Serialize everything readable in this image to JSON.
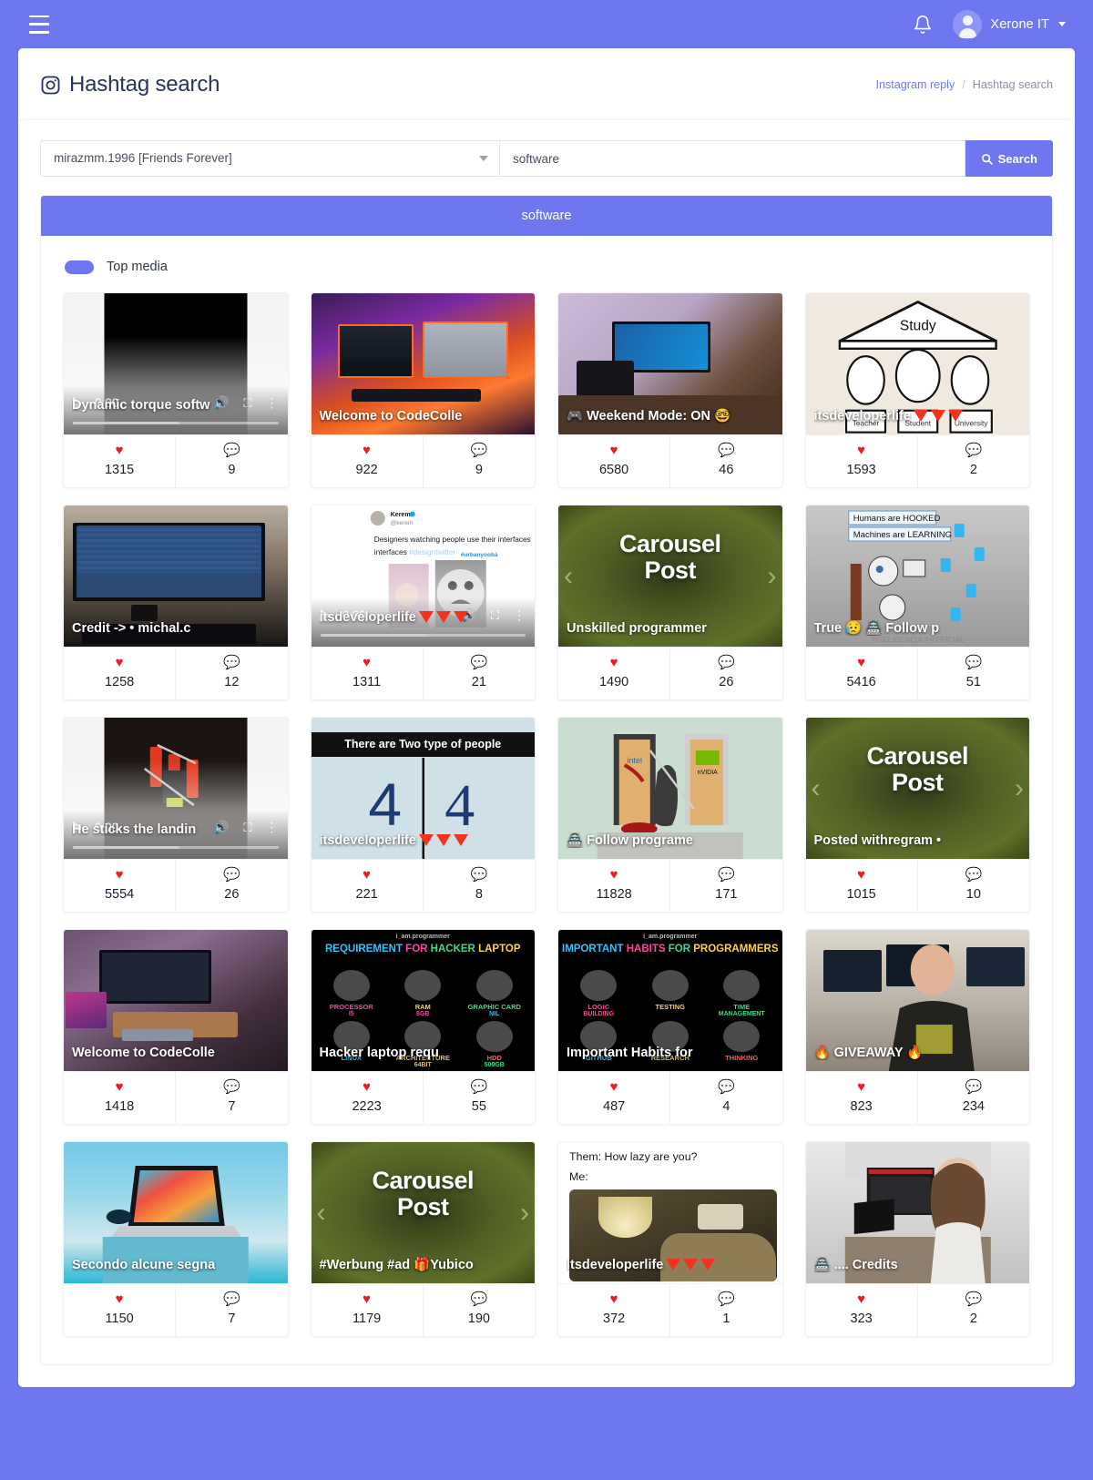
{
  "topnav": {
    "menu_icon": "hamburger-icon",
    "notification_icon": "bell-icon",
    "user_name": "Xerone IT",
    "avatar_icon": "user-avatar-icon",
    "caret_icon": "chevron-down-icon"
  },
  "page": {
    "title": "Hashtag search",
    "title_icon": "instagram-icon",
    "breadcrumb": {
      "parent": "Instagram reply",
      "separator": "/",
      "current": "Hashtag search"
    }
  },
  "search": {
    "account_selected": "mirazmm.1996 [Friends Forever]",
    "keyword_value": "software",
    "keyword_placeholder": "software",
    "button_label": "Search",
    "button_icon": "search-icon"
  },
  "results": {
    "header": "software",
    "toggle_label": "Top media",
    "toggle_on": true
  },
  "colors": {
    "brand": "#6e77f0",
    "heart": "#ec1c24",
    "comment": "#6271e8",
    "title_text": "#29335c"
  },
  "icons": {
    "like": "heart-icon",
    "comment": "comment-bubble-icon",
    "play": "play-icon",
    "volume": "volume-icon",
    "fullscreen": "fullscreen-icon",
    "more": "more-vertical-icon",
    "prev": "chevron-left-icon",
    "next": "chevron-right-icon"
  },
  "media": [
    {
      "caption": "Dynamic torque softw",
      "likes": "1315",
      "comments": "9",
      "kind": "video",
      "time": "0:00",
      "style": "black-video"
    },
    {
      "caption": "Welcome to CodeColle",
      "likes": "922",
      "comments": "9",
      "kind": "image",
      "style": "rgb-desk"
    },
    {
      "caption": "🎮 Weekend Mode: ON 🤓",
      "likes": "6580",
      "comments": "46",
      "kind": "image",
      "style": "gamer"
    },
    {
      "caption": "itsdeveloperlife",
      "likes": "1593",
      "comments": "2",
      "kind": "image",
      "style": "study-cartoon",
      "triangles": 3
    },
    {
      "caption": "Credit -> • michal.c",
      "likes": "1258",
      "comments": "12",
      "kind": "image",
      "style": "ultrawide-code"
    },
    {
      "caption": "itsdeveloperlife",
      "likes": "1311",
      "comments": "21",
      "kind": "video",
      "time": "0:00",
      "style": "tweet-video",
      "triangles": 3
    },
    {
      "caption": "Unskilled programmer",
      "likes": "1490",
      "comments": "26",
      "kind": "carousel",
      "style": "carousel",
      "carousel_title": "Carousel Post"
    },
    {
      "caption": "True 😥 🏯 Follow p",
      "likes": "5416",
      "comments": "51",
      "kind": "image",
      "style": "robots"
    },
    {
      "caption": "He sticks the landin",
      "likes": "5554",
      "comments": "26",
      "kind": "video",
      "time": "0:00",
      "style": "robot-arm"
    },
    {
      "caption": "itsdeveloperlife",
      "likes": "221",
      "comments": "8",
      "kind": "image",
      "style": "two-types",
      "triangles": 3
    },
    {
      "caption": "🏯 Follow programe",
      "likes": "11828",
      "comments": "171",
      "kind": "image",
      "style": "doors"
    },
    {
      "caption": "Posted withregram •",
      "likes": "1015",
      "comments": "10",
      "kind": "carousel",
      "style": "carousel",
      "carousel_title": "Carousel Post"
    },
    {
      "caption": "Welcome to CodeColle",
      "likes": "1418",
      "comments": "7",
      "kind": "image",
      "style": "purple-desk"
    },
    {
      "caption": "Hacker laptop requ",
      "likes": "2223",
      "comments": "55",
      "kind": "image",
      "style": "hacker-infographic"
    },
    {
      "caption": "Important Habits for",
      "likes": "487",
      "comments": "4",
      "kind": "image",
      "style": "habits-infographic"
    },
    {
      "caption": "🔥 GIVEAWAY 🔥",
      "likes": "823",
      "comments": "234",
      "kind": "image",
      "style": "giveaway"
    },
    {
      "caption": "Secondo alcune segna",
      "likes": "1150",
      "comments": "7",
      "kind": "image",
      "style": "macbook"
    },
    {
      "caption": "#Werbung #ad 🎁Yubico",
      "likes": "1179",
      "comments": "190",
      "kind": "carousel",
      "style": "carousel",
      "carousel_title": "Carousel Post"
    },
    {
      "caption": "itsdeveloperlife",
      "likes": "372",
      "comments": "1",
      "kind": "image",
      "style": "lazy-meme",
      "triangles": 3,
      "overlay_lines": [
        "Them: How lazy are you?",
        "Me:"
      ]
    },
    {
      "caption": "🏯 .... Credits",
      "likes": "323",
      "comments": "2",
      "kind": "image",
      "style": "woman-desk"
    }
  ],
  "infographics": {
    "hacker": {
      "brand": "i_am.programmer",
      "heading_parts": [
        "REQUIREMENT",
        "FOR",
        "HACKER",
        "LAPTOP"
      ],
      "cells": [
        {
          "l1": "PROCESSOR",
          "l2": "I5",
          "c1": "#ff45a0",
          "c2": "#ff45a0"
        },
        {
          "l1": "RAM",
          "l2": "8GB",
          "c1": "#ffd23f",
          "c2": "#ff45a0"
        },
        {
          "l1": "GRAPHIC CARD",
          "l2": "NIL",
          "c1": "#3ddc84",
          "c2": "#2ec4ff"
        },
        {
          "l1": "LINUX",
          "l2": "",
          "c1": "#2ec4ff",
          "c2": "#2ec4ff"
        },
        {
          "l1": "ARCHITECTURE",
          "l2": "64BIT",
          "c1": "#e0c060",
          "c2": "#e0c060"
        },
        {
          "l1": "HDD",
          "l2": "500GB",
          "c1": "#ff5a5a",
          "c2": "#3ddc84"
        }
      ]
    },
    "habits": {
      "brand": "i_am.programmer",
      "heading_parts": [
        "IMPORTANT",
        "HABITS",
        "FOR",
        "PROGRAMMERS"
      ],
      "cells": [
        {
          "l1": "LOGIC",
          "l2": "BUILDING",
          "c1": "#ff45a0",
          "c2": "#ff45a0"
        },
        {
          "l1": "TESTING",
          "l2": "",
          "c1": "#ffd23f",
          "c2": "#ffd23f"
        },
        {
          "l1": "TIME",
          "l2": "MANAGEMENT",
          "c1": "#3ddc84",
          "c2": "#3ddc84"
        },
        {
          "l1": "GITHUB",
          "l2": "",
          "c1": "#2ec4ff",
          "c2": "#2ec4ff"
        },
        {
          "l1": "RESEARCH",
          "l2": "",
          "c1": "#e0c060",
          "c2": "#e0c060"
        },
        {
          "l1": "THINKING",
          "l2": "",
          "c1": "#ff5a5a",
          "c2": "#ff5a5a"
        }
      ]
    },
    "two_types_header": "There are Two type of people",
    "robots_lines": [
      "Humans are HOOKED",
      "Machines are LEARNING"
    ],
    "robots_footer": "INTELIGENCIA ARTIFICIAL",
    "study_label": "Study",
    "study_roles": [
      "Teacher",
      "Student",
      "University"
    ],
    "tweet": {
      "name": "Kerem",
      "handle": "@kerem",
      "text": "Designers watching people use their interfaces ",
      "hashtag": "#designtwitter",
      "tag": "#urbanyoobá"
    }
  }
}
